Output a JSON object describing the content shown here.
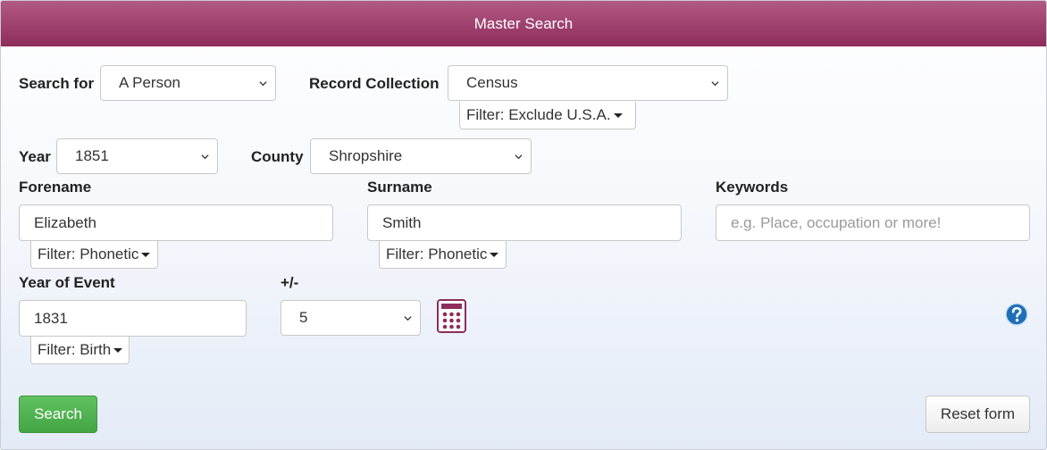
{
  "header": {
    "title": "Master Search"
  },
  "search_for": {
    "label": "Search for",
    "value": "A Person"
  },
  "record_collection": {
    "label": "Record Collection",
    "value": "Census",
    "filter": "Filter: Exclude U.S.A."
  },
  "year": {
    "label": "Year",
    "value": "1851"
  },
  "county": {
    "label": "County",
    "value": "Shropshire"
  },
  "forename": {
    "label": "Forename",
    "value": "Elizabeth",
    "filter": "Filter: Phonetic"
  },
  "surname": {
    "label": "Surname",
    "value": "Smith",
    "filter": "Filter: Phonetic"
  },
  "keywords": {
    "label": "Keywords",
    "placeholder": "e.g. Place, occupation or more!"
  },
  "year_of_event": {
    "label": "Year of Event",
    "value": "1831",
    "filter": "Filter: Birth"
  },
  "range": {
    "label": "+/-",
    "value": "5"
  },
  "icons": {
    "calculator": "calculator-icon",
    "help": "help-icon",
    "chevron": "chevron-down-icon",
    "caret": "caret-down-icon"
  },
  "colors": {
    "header": "#9b3a69",
    "search_button": "#4cae4c",
    "icon_accent": "#8e2c5c",
    "help_blue": "#1f6fb8"
  },
  "buttons": {
    "search": "Search",
    "reset": "Reset form"
  }
}
